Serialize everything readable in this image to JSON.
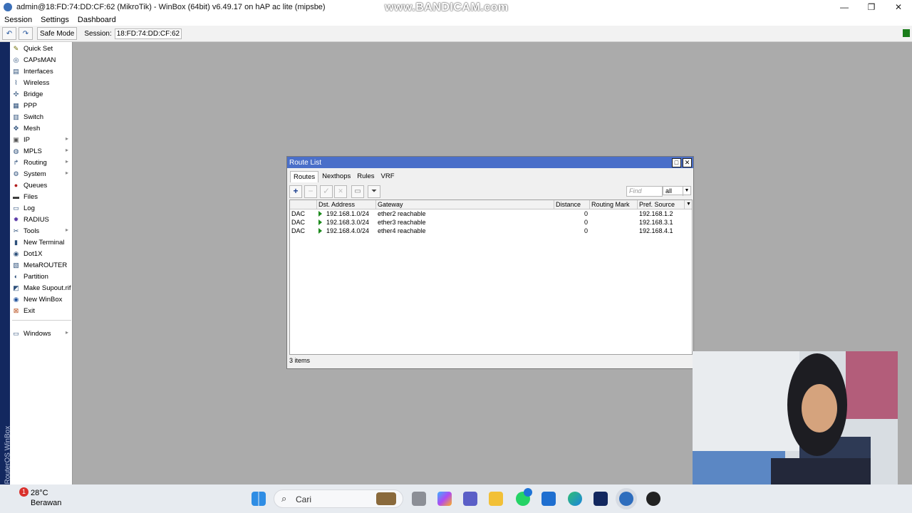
{
  "window": {
    "title": "admin@18:FD:74:DD:CF:62 (MikroTik) - WinBox (64bit) v6.49.17 on hAP ac lite (mipsbe)",
    "watermark": "www.BANDICAM.com",
    "controls": {
      "minimize": "—",
      "maximize": "❐",
      "close": "✕"
    }
  },
  "menubar": [
    "Session",
    "Settings",
    "Dashboard"
  ],
  "toolbar": {
    "undo_icon": "↶",
    "redo_icon": "↷",
    "safe_mode": "Safe Mode",
    "session_label": "Session:",
    "session_value": "18:FD:74:DD:CF:62"
  },
  "side_label": "RouterOS WinBox",
  "sidebar": {
    "items": [
      {
        "label": "Quick Set",
        "icon": "wand-icon",
        "submenu": false
      },
      {
        "label": "CAPsMAN",
        "icon": "capsman-icon",
        "submenu": false
      },
      {
        "label": "Interfaces",
        "icon": "interfaces-icon",
        "submenu": false
      },
      {
        "label": "Wireless",
        "icon": "wireless-icon",
        "submenu": false
      },
      {
        "label": "Bridge",
        "icon": "bridge-icon",
        "submenu": false
      },
      {
        "label": "PPP",
        "icon": "ppp-icon",
        "submenu": false
      },
      {
        "label": "Switch",
        "icon": "switch-icon",
        "submenu": false
      },
      {
        "label": "Mesh",
        "icon": "mesh-icon",
        "submenu": false
      },
      {
        "label": "IP",
        "icon": "ip-icon",
        "submenu": true
      },
      {
        "label": "MPLS",
        "icon": "mpls-icon",
        "submenu": true
      },
      {
        "label": "Routing",
        "icon": "routing-icon",
        "submenu": true
      },
      {
        "label": "System",
        "icon": "system-icon",
        "submenu": true
      },
      {
        "label": "Queues",
        "icon": "queues-icon",
        "submenu": false
      },
      {
        "label": "Files",
        "icon": "folder-icon",
        "submenu": false
      },
      {
        "label": "Log",
        "icon": "log-icon",
        "submenu": false
      },
      {
        "label": "RADIUS",
        "icon": "radius-icon",
        "submenu": false
      },
      {
        "label": "Tools",
        "icon": "tools-icon",
        "submenu": true
      },
      {
        "label": "New Terminal",
        "icon": "terminal-icon",
        "submenu": false
      },
      {
        "label": "Dot1X",
        "icon": "dot1x-icon",
        "submenu": false
      },
      {
        "label": "MetaROUTER",
        "icon": "metarouter-icon",
        "submenu": false
      },
      {
        "label": "Partition",
        "icon": "partition-icon",
        "submenu": false
      },
      {
        "label": "Make Supout.rif",
        "icon": "supout-icon",
        "submenu": false
      },
      {
        "label": "New WinBox",
        "icon": "winbox-icon",
        "submenu": false
      },
      {
        "label": "Exit",
        "icon": "exit-icon",
        "submenu": false
      }
    ],
    "windows_item": {
      "label": "Windows",
      "icon": "windows-icon",
      "submenu": true
    }
  },
  "route_list": {
    "title": "Route List",
    "tabs": [
      "Routes",
      "Nexthops",
      "Rules",
      "VRF"
    ],
    "active_tab": "Routes",
    "find_placeholder": "Find",
    "filter_value": "all",
    "columns": [
      "",
      "Dst. Address",
      "Gateway",
      "Distance",
      "Routing Mark",
      "Pref. Source"
    ],
    "rows": [
      {
        "flags": "DAC",
        "dst": "192.168.1.0/24",
        "gateway": "ether2 reachable",
        "distance": "0",
        "mark": "",
        "pref": "192.168.1.2"
      },
      {
        "flags": "DAC",
        "dst": "192.168.3.0/24",
        "gateway": "ether3 reachable",
        "distance": "0",
        "mark": "",
        "pref": "192.168.3.1"
      },
      {
        "flags": "DAC",
        "dst": "192.168.4.0/24",
        "gateway": "ether4 reachable",
        "distance": "0",
        "mark": "",
        "pref": "192.168.4.1"
      }
    ],
    "status": "3 items"
  },
  "taskbar": {
    "weather_temp": "28°C",
    "weather_desc": "Berawan",
    "weather_badge": "1",
    "search_label": "Cari"
  },
  "colors": {
    "workspace": "#ababab",
    "sidebar_strip": "#13285f",
    "window_title": "#4a6fc9",
    "route_active": "#1c8a1c"
  }
}
